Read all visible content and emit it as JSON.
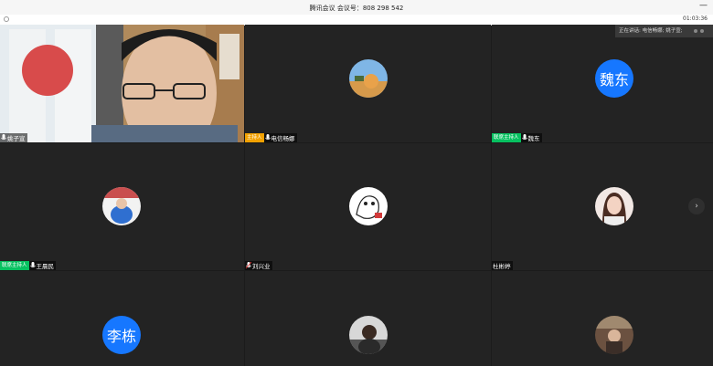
{
  "window": {
    "title": "腾讯会议  会议号：808 298 542",
    "minimize_glyph": "—",
    "timer": "01:03:36"
  },
  "speaking_indicator": "正在讲话: 电信畅娜; 姚子宣;",
  "next_page_glyph": "›",
  "participants": [
    {
      "name": "姚子宣",
      "badge": "",
      "avatar_type": "video"
    },
    {
      "name": "电信畅娜",
      "badge": "主持人",
      "badge_kind": "host",
      "avatar_type": "image"
    },
    {
      "name": "魏东",
      "badge": "联席主持人",
      "badge_kind": "cohost",
      "avatar_type": "text",
      "avatar_text": "魏东"
    },
    {
      "name": "王晨民",
      "badge": "联席主持人",
      "badge_kind": "cohost",
      "avatar_type": "image"
    },
    {
      "name": "刘兴业",
      "badge": "",
      "avatar_type": "image"
    },
    {
      "name": "杜彬婷",
      "badge": "",
      "avatar_type": "image"
    },
    {
      "name": "",
      "badge": "",
      "avatar_type": "text",
      "avatar_text": "李栋"
    },
    {
      "name": "",
      "badge": "",
      "avatar_type": "image"
    },
    {
      "name": "",
      "badge": "",
      "avatar_type": "image"
    }
  ]
}
